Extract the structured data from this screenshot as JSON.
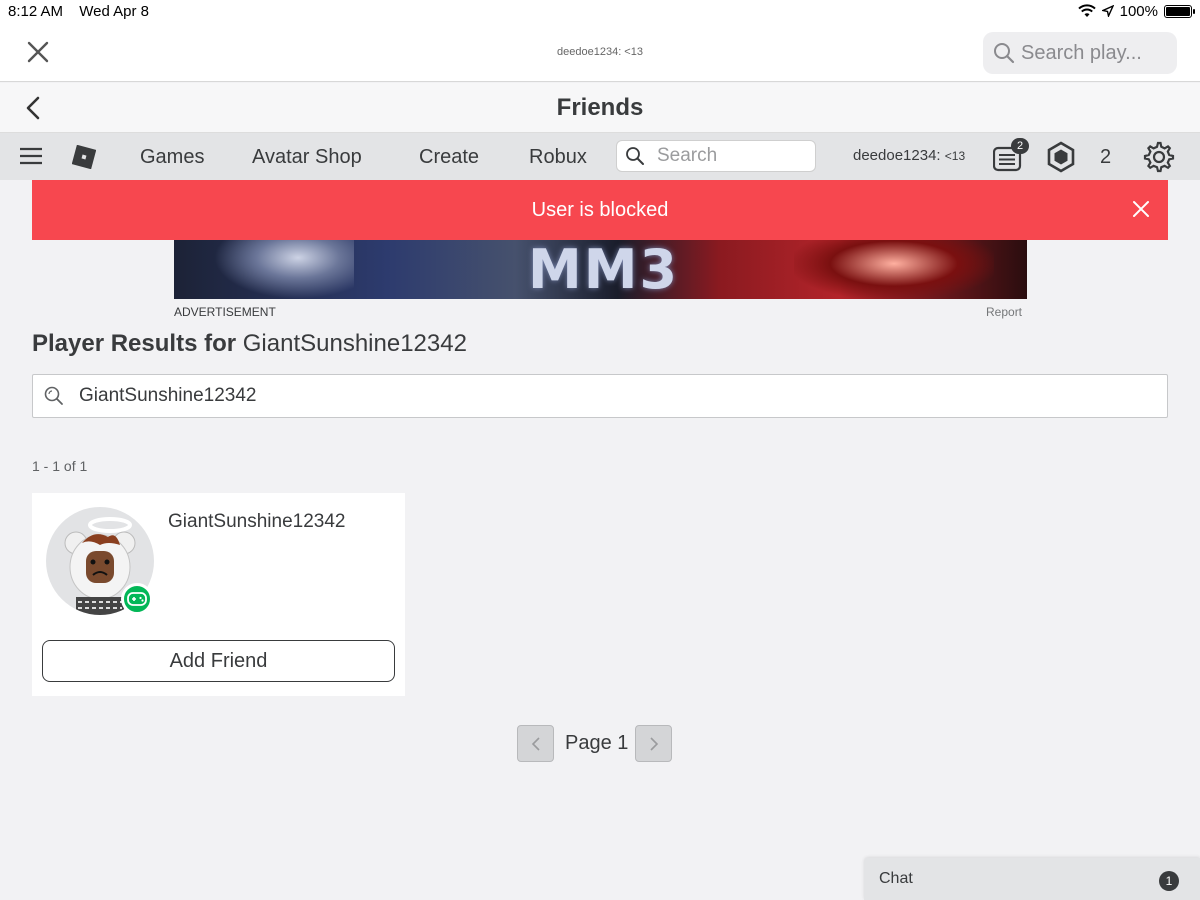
{
  "statusbar": {
    "time": "8:12 AM",
    "date": "Wed Apr 8",
    "battery": "100%"
  },
  "browser": {
    "page_title": "deedoe1234: <13",
    "search_placeholder": "Search play..."
  },
  "header": {
    "title": "Friends"
  },
  "nav": {
    "links": [
      "Games",
      "Avatar Shop",
      "Create",
      "Robux"
    ],
    "search_placeholder": "Search",
    "username": "deedoe1234:",
    "username_suffix": "<13",
    "messages_badge": "2",
    "robux_count": "2"
  },
  "alert": {
    "message": "User is blocked"
  },
  "ad": {
    "banner_text": "MM3",
    "label": "ADVERTISEMENT",
    "report": "Report"
  },
  "results": {
    "title_prefix": "Player Results for",
    "query": "GiantSunshine12342",
    "search_value": "GiantSunshine12342",
    "count_text": "1 - 1 of 1",
    "players": [
      {
        "name": "GiantSunshine12342",
        "button": "Add Friend"
      }
    ]
  },
  "pagination": {
    "label": "Page 1"
  },
  "chat": {
    "label": "Chat",
    "badge": "1"
  },
  "colors": {
    "alert": "#f7474f",
    "presence": "#02b757",
    "nav_bg": "#e3e4e6"
  }
}
